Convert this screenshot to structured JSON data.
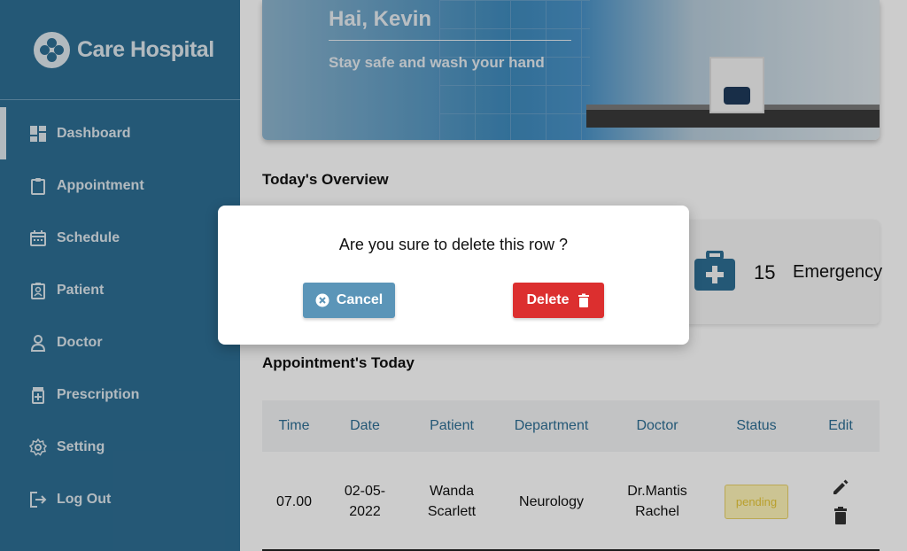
{
  "brand": {
    "name": "Care Hospital",
    "icon": "clover-logo-icon"
  },
  "sidebar": {
    "items": [
      {
        "label": "Dashboard",
        "icon": "dashboard-icon",
        "active": true
      },
      {
        "label": "Appointment",
        "icon": "clipboard-icon"
      },
      {
        "label": "Schedule",
        "icon": "calendar-icon"
      },
      {
        "label": "Patient",
        "icon": "patient-badge-icon"
      },
      {
        "label": "Doctor",
        "icon": "person-icon"
      },
      {
        "label": "Prescription",
        "icon": "medicine-bottle-icon"
      },
      {
        "label": "Setting",
        "icon": "gear-icon"
      },
      {
        "label": "Log Out",
        "icon": "logout-icon"
      }
    ]
  },
  "hero": {
    "greeting": "Hai, Kevin",
    "subtitle": "Stay safe and wash your hand"
  },
  "overview": {
    "title": "Today's Overview",
    "cards": [
      {
        "count": "15",
        "label": "Emergency",
        "icon": "first-aid-kit-icon"
      }
    ]
  },
  "appointments": {
    "title": "Appointment's Today",
    "columns": [
      "Time",
      "Date",
      "Patient",
      "Department",
      "Doctor",
      "Status",
      "Edit"
    ],
    "rows": [
      {
        "time": "07.00",
        "date": "02-05-2022",
        "patient": "Wanda Scarlett",
        "department": "Neurology",
        "doctor": "Dr.Mantis Rachel",
        "status": "pending"
      }
    ]
  },
  "modal": {
    "message": "Are you sure to delete this row ?",
    "cancel_label": "Cancel",
    "delete_label": "Delete"
  },
  "colors": {
    "sidebar": "#2e6e94",
    "cancel": "#5b95b8",
    "delete": "#dc2f2f",
    "pending_bg": "#fff6b8"
  }
}
